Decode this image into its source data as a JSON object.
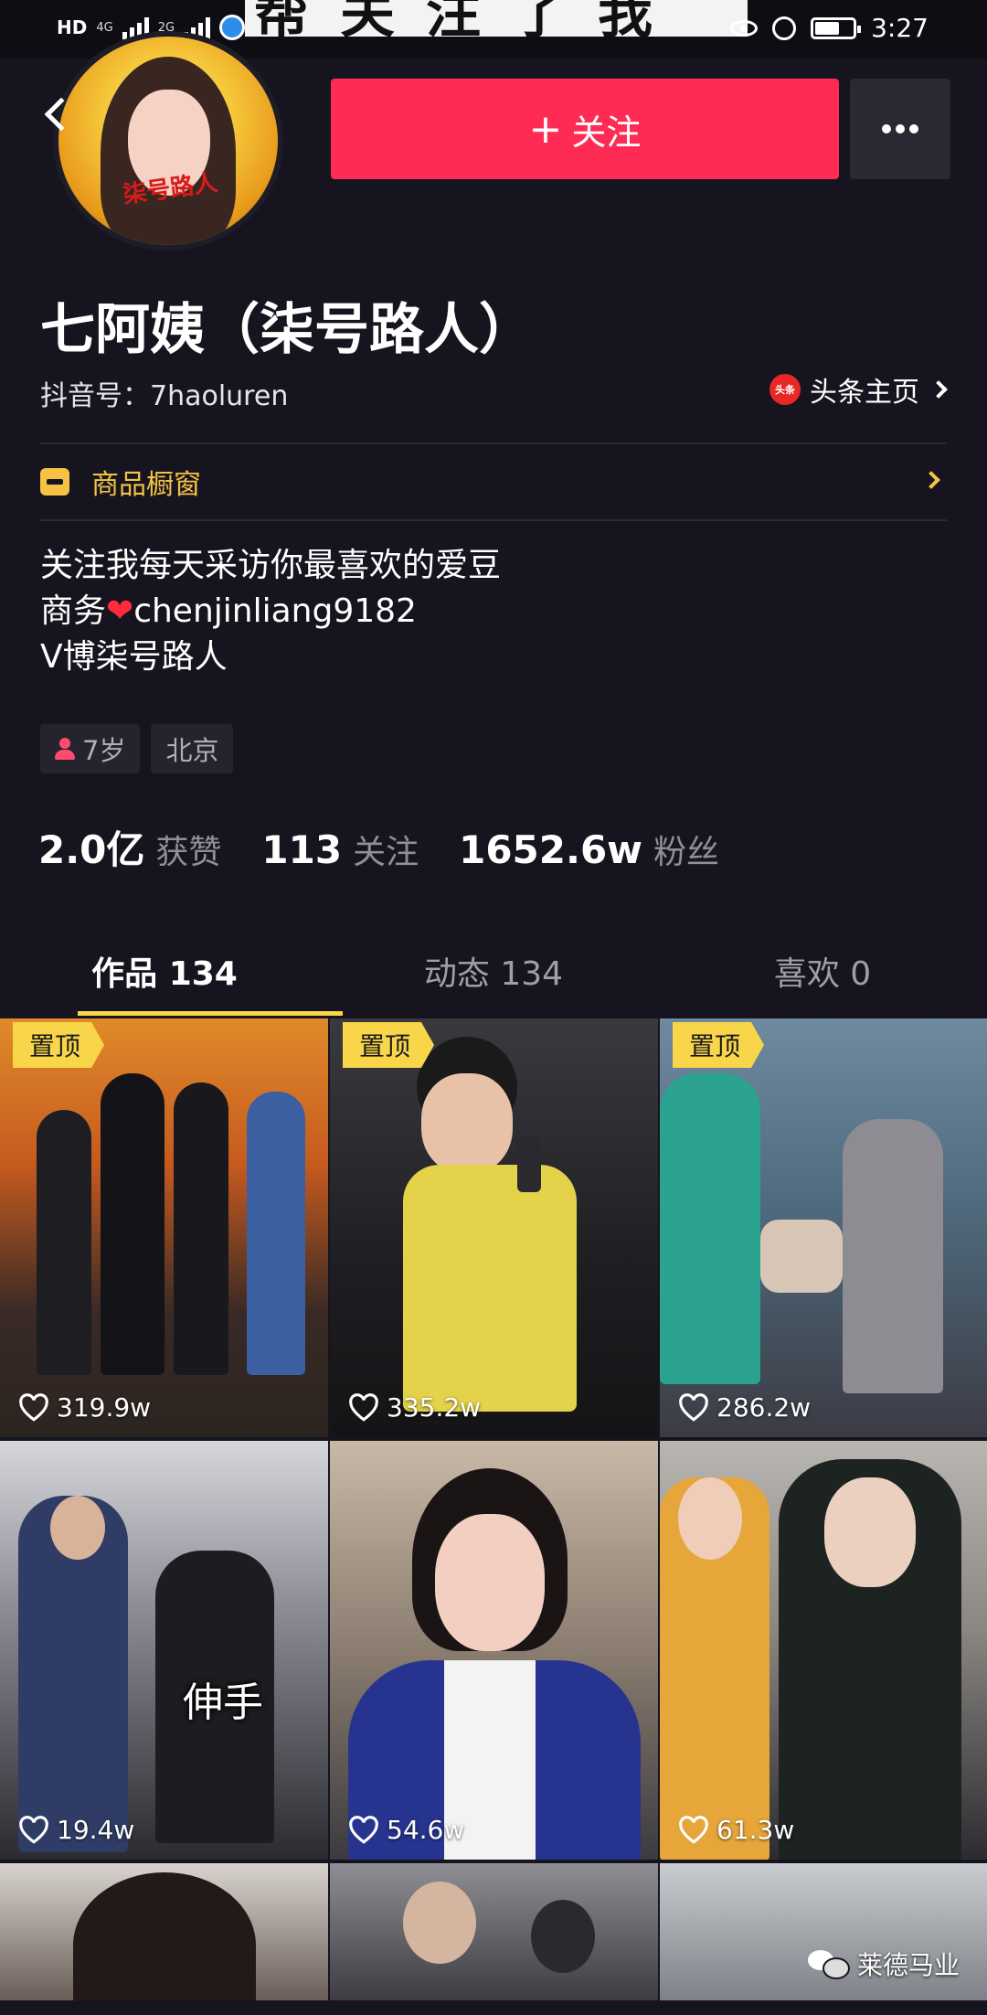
{
  "status_bar": {
    "left_badge": "HD",
    "net_1": "4G",
    "net_2": "2G",
    "banner_text": "帮关注了我",
    "time": "3:27"
  },
  "profile": {
    "avatar_stamp": "柒号路人",
    "follow_label": "关注",
    "nickname": "七阿姨（柒号路人）",
    "douyin_id": "抖音号：7haoluren",
    "toutiao_logo": "头条",
    "toutiao_label": "头条主页",
    "shop_label": "商品橱窗",
    "bio": {
      "line1": "关注我每天采访你最喜欢的爱豆",
      "line2_prefix": "商务",
      "line2_heart": "❤",
      "line2_suffix": "chenjinliang9182",
      "line3": "V博柒号路人"
    },
    "tags": {
      "age": "7岁",
      "city": "北京"
    },
    "stats": {
      "likes_num": "2.0亿",
      "likes_label": "获赞",
      "following_num": "113",
      "following_label": "关注",
      "fans_num": "1652.6w",
      "fans_label": "粉丝"
    }
  },
  "tabs": {
    "works": "作品 134",
    "activity": "动态 134",
    "liked": "喜欢 0"
  },
  "videos": {
    "pin_label": "置顶",
    "v1_likes": "319.9w",
    "v2_likes": "335.2w",
    "v3_likes": "286.2w",
    "v4_likes": "19.4w",
    "v4_caption": "伸手",
    "v5_likes": "54.6w",
    "v6_likes": "61.3w"
  },
  "watermark": "莱德马业",
  "colors": {
    "background": "#16151f",
    "follow_button": "#fe2c55",
    "accent_yellow": "#f9d649",
    "shop_yellow": "#f5c244",
    "muted_text": "#8f8e99"
  }
}
